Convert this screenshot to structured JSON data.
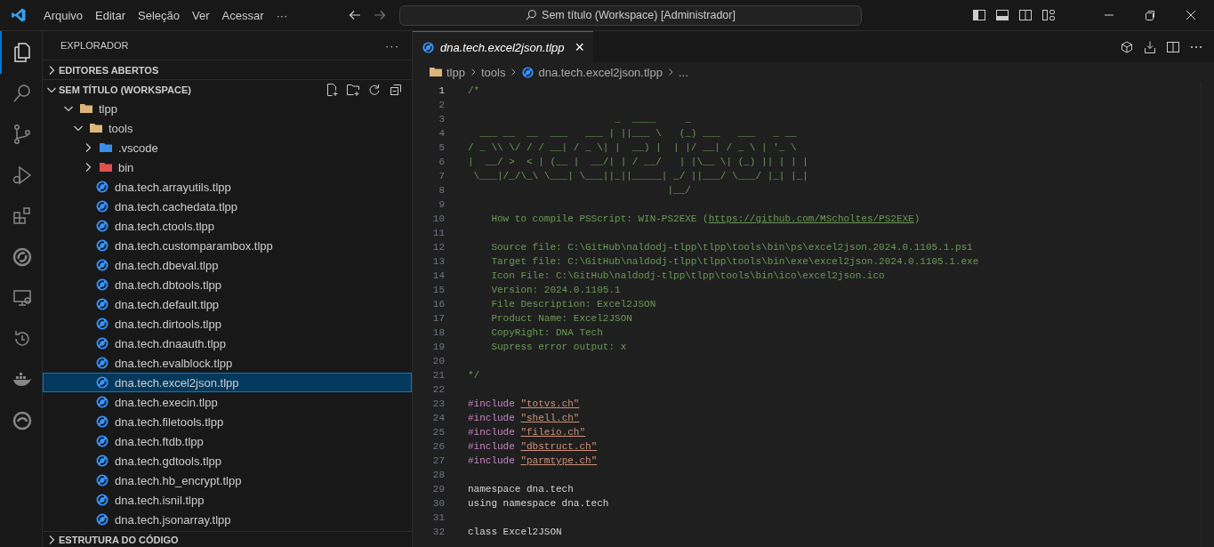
{
  "menu": [
    "Arquivo",
    "Editar",
    "Seleção",
    "Ver",
    "Acessar",
    "···"
  ],
  "command_center": {
    "text": "Sem título (Workspace) [Administrador]"
  },
  "activity_bar": [
    {
      "kind": "files",
      "selected": true
    },
    {
      "kind": "search",
      "selected": false
    },
    {
      "kind": "git",
      "selected": false
    },
    {
      "kind": "debug",
      "selected": false
    },
    {
      "kind": "extensions",
      "selected": false
    },
    {
      "kind": "tlpp",
      "selected": false
    },
    {
      "kind": "remote",
      "selected": false
    },
    {
      "kind": "timeline",
      "selected": false
    },
    {
      "kind": "docker",
      "selected": false
    },
    {
      "kind": "edge",
      "selected": false
    }
  ],
  "sidebar": {
    "title": "EXPLORADOR",
    "more": "···",
    "open_editors": {
      "label": "EDITORES ABERTOS",
      "expanded": false
    },
    "workspace": {
      "label": "SEM TÍTULO (WORKSPACE)",
      "expanded": true
    },
    "tree": [
      {
        "label": "tlpp",
        "kind": "folder",
        "expanded": true,
        "selected": false,
        "children": [
          {
            "label": "tools",
            "kind": "folder",
            "expanded": true,
            "selected": false,
            "children": [
              {
                "label": ".vscode",
                "kind": "vscode",
                "expanded": false,
                "selected": false
              },
              {
                "label": "bin",
                "kind": "bin",
                "expanded": false,
                "selected": false
              },
              {
                "label": "dna.tech.arrayutils.tlpp",
                "kind": "file",
                "selected": false
              },
              {
                "label": "dna.tech.cachedata.tlpp",
                "kind": "file",
                "selected": false
              },
              {
                "label": "dna.tech.ctools.tlpp",
                "kind": "file",
                "selected": false
              },
              {
                "label": "dna.tech.customparambox.tlpp",
                "kind": "file",
                "selected": false
              },
              {
                "label": "dna.tech.dbeval.tlpp",
                "kind": "file",
                "selected": false
              },
              {
                "label": "dna.tech.dbtools.tlpp",
                "kind": "file",
                "selected": false
              },
              {
                "label": "dna.tech.default.tlpp",
                "kind": "file",
                "selected": false
              },
              {
                "label": "dna.tech.dirtools.tlpp",
                "kind": "file",
                "selected": false
              },
              {
                "label": "dna.tech.dnaauth.tlpp",
                "kind": "file",
                "selected": false
              },
              {
                "label": "dna.tech.evalblock.tlpp",
                "kind": "file",
                "selected": false
              },
              {
                "label": "dna.tech.excel2json.tlpp",
                "kind": "file",
                "selected": true
              },
              {
                "label": "dna.tech.execin.tlpp",
                "kind": "file",
                "selected": false
              },
              {
                "label": "dna.tech.filetools.tlpp",
                "kind": "file",
                "selected": false
              },
              {
                "label": "dna.tech.ftdb.tlpp",
                "kind": "file",
                "selected": false
              },
              {
                "label": "dna.tech.gdtools.tlpp",
                "kind": "file",
                "selected": false
              },
              {
                "label": "dna.tech.hb_encrypt.tlpp",
                "kind": "file",
                "selected": false
              },
              {
                "label": "dna.tech.isnil.tlpp",
                "kind": "file",
                "selected": false
              },
              {
                "label": "dna.tech.jsonarray.tlpp",
                "kind": "file",
                "selected": false
              }
            ]
          }
        ]
      }
    ],
    "outline": {
      "label": "ESTRUTURA DO CÓDIGO",
      "expanded": false
    }
  },
  "tab": {
    "label": "dna.tech.excel2json.tlpp",
    "close": "×"
  },
  "breadcrumbs": [
    {
      "label": "tlpp",
      "kind": "folder"
    },
    {
      "label": "tools",
      "kind": "plain"
    },
    {
      "label": "dna.tech.excel2json.tlpp",
      "kind": "file"
    },
    {
      "label": "...",
      "kind": "plain"
    }
  ],
  "code": [
    {
      "number": "1",
      "selected": true,
      "tokens": [
        {
          "text": "/*",
          "kind": "comment"
        }
      ]
    },
    {
      "number": "2",
      "selected": false
    },
    {
      "number": "3",
      "selected": false,
      "tokens": [
        {
          "text": "                         _  ____     _",
          "kind": "comment"
        }
      ]
    },
    {
      "number": "4",
      "selected": false,
      "tokens": [
        {
          "text": "  ___ __  __  ___   ___ | ||___ \\   (_) ___   ___   _ __",
          "kind": "comment"
        }
      ]
    },
    {
      "number": "5",
      "selected": false,
      "tokens": [
        {
          "text": "/ _ \\\\ \\/ / / __| / _ \\| |  __) |  | |/ __| / _ \\ | '_ \\",
          "kind": "comment"
        }
      ]
    },
    {
      "number": "6",
      "selected": false,
      "tokens": [
        {
          "text": "|  __/ >  < | (__ |  __/| | / __/   | |\\__ \\| (_) || | | |",
          "kind": "comment"
        }
      ]
    },
    {
      "number": "7",
      "selected": false,
      "tokens": [
        {
          "text": " \\___|/_/\\_\\ \\___| \\___||_||_____| _/ ||___/ \\___/ |_| |_|",
          "kind": "comment"
        }
      ]
    },
    {
      "number": "8",
      "selected": false,
      "tokens": [
        {
          "text": "                                  |__/",
          "kind": "comment"
        }
      ]
    },
    {
      "number": "9",
      "selected": false
    },
    {
      "number": "10",
      "selected": false,
      "tokens": [
        {
          "text": "    How to compile PSScript: WIN-PS2EXE (",
          "kind": "comment"
        },
        {
          "text": "https://github.com/MScholtes/PS2EXE",
          "kind": "link"
        },
        {
          "text": ")",
          "kind": "comment"
        }
      ]
    },
    {
      "number": "11",
      "selected": false
    },
    {
      "number": "12",
      "selected": false,
      "tokens": [
        {
          "text": "    Source file: C:\\GitHub\\naldodj-tlpp\\tlpp\\tools\\bin\\ps\\excel2json.2024.0.1105.1.ps1",
          "kind": "comment"
        }
      ]
    },
    {
      "number": "13",
      "selected": false,
      "tokens": [
        {
          "text": "    Target file: C:\\GitHub\\naldodj-tlpp\\tlpp\\tools\\bin\\exe\\excel2json.2024.0.1105.1.exe",
          "kind": "comment"
        }
      ]
    },
    {
      "number": "14",
      "selected": false,
      "tokens": [
        {
          "text": "    Icon File: C:\\GitHub\\naldodj-tlpp\\tlpp\\tools\\bin\\ico\\excel2json.ico",
          "kind": "comment"
        }
      ]
    },
    {
      "number": "15",
      "selected": false,
      "tokens": [
        {
          "text": "    Version: 2024.0.1105.1",
          "kind": "comment"
        }
      ]
    },
    {
      "number": "16",
      "selected": false,
      "tokens": [
        {
          "text": "    File Description: Excel2JSON",
          "kind": "comment"
        }
      ]
    },
    {
      "number": "17",
      "selected": false,
      "tokens": [
        {
          "text": "    Product Name: Excel2JSON",
          "kind": "comment"
        }
      ]
    },
    {
      "number": "18",
      "selected": false,
      "tokens": [
        {
          "text": "    CopyRight: DNA Tech",
          "kind": "comment"
        }
      ]
    },
    {
      "number": "19",
      "selected": false,
      "tokens": [
        {
          "text": "    Supress error output: x",
          "kind": "comment"
        }
      ]
    },
    {
      "number": "20",
      "selected": false
    },
    {
      "number": "21",
      "selected": false,
      "tokens": [
        {
          "text": "*/",
          "kind": "comment"
        }
      ]
    },
    {
      "number": "22",
      "selected": false
    },
    {
      "number": "23",
      "selected": false,
      "tokens": [
        {
          "text": "#include ",
          "kind": "keyword"
        },
        {
          "text": "\"totvs.ch\"",
          "kind": "string"
        }
      ]
    },
    {
      "number": "24",
      "selected": false,
      "tokens": [
        {
          "text": "#include ",
          "kind": "keyword"
        },
        {
          "text": "\"shell.ch\"",
          "kind": "string"
        }
      ]
    },
    {
      "number": "25",
      "selected": false,
      "tokens": [
        {
          "text": "#include ",
          "kind": "keyword"
        },
        {
          "text": "\"fileio.ch\"",
          "kind": "string"
        }
      ]
    },
    {
      "number": "26",
      "selected": false,
      "tokens": [
        {
          "text": "#include ",
          "kind": "keyword"
        },
        {
          "text": "\"dbstruct.ch\"",
          "kind": "string"
        }
      ]
    },
    {
      "number": "27",
      "selected": false,
      "tokens": [
        {
          "text": "#include ",
          "kind": "keyword"
        },
        {
          "text": "\"parmtype.ch\"",
          "kind": "string"
        }
      ]
    },
    {
      "number": "28",
      "selected": false
    },
    {
      "number": "29",
      "selected": false,
      "tokens": [
        {
          "text": "namespace dna.tech",
          "kind": "plain"
        }
      ]
    },
    {
      "number": "30",
      "selected": false,
      "tokens": [
        {
          "text": "using namespace dna.tech",
          "kind": "plain"
        }
      ]
    },
    {
      "number": "31",
      "selected": false
    },
    {
      "number": "32",
      "selected": false,
      "tokens": [
        {
          "text": "class Excel2JSON",
          "kind": "plain"
        }
      ]
    }
  ]
}
